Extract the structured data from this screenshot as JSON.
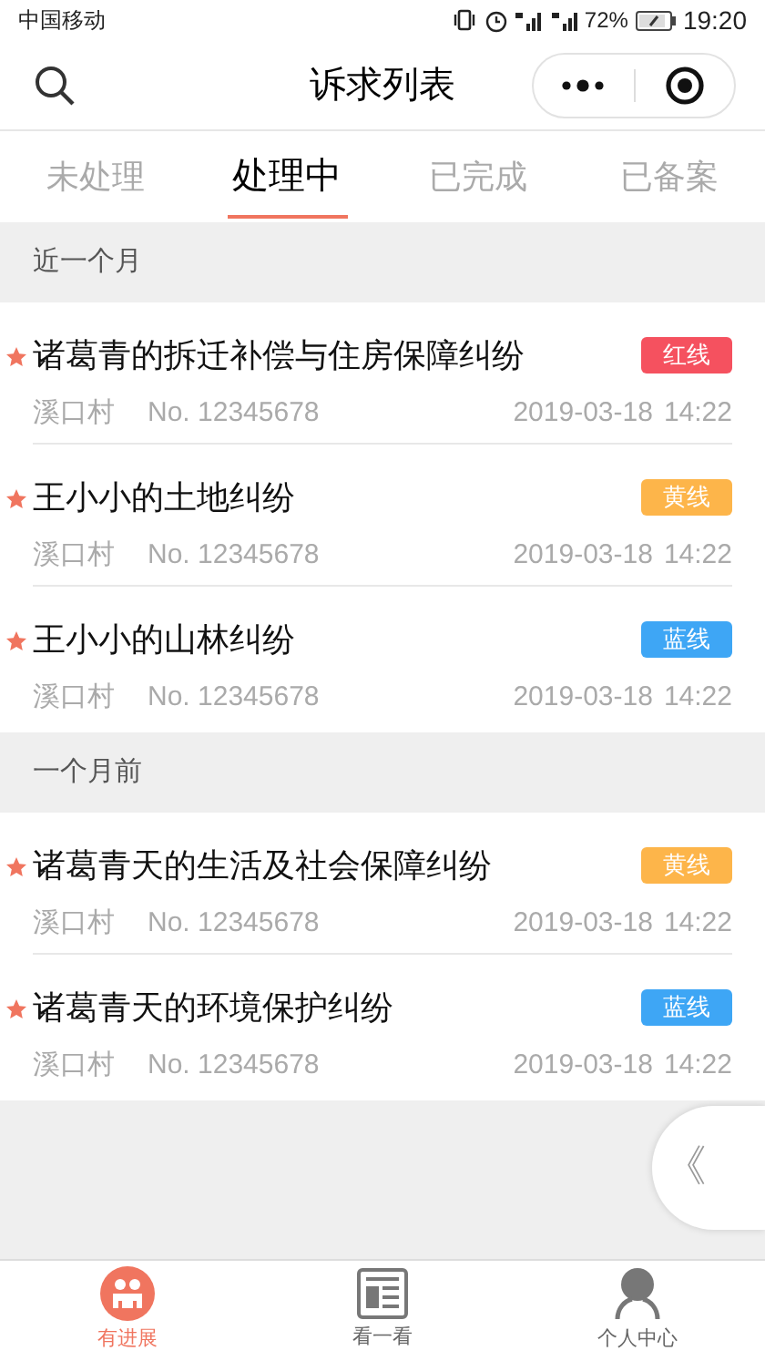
{
  "status_bar": {
    "carrier": "中国移动",
    "battery": "72%",
    "time": "19:20"
  },
  "nav": {
    "title": "诉求列表"
  },
  "tabs": [
    {
      "label": "未处理",
      "selected": false
    },
    {
      "label": "处理中",
      "selected": true
    },
    {
      "label": "已完成",
      "selected": false
    },
    {
      "label": "已备案",
      "selected": false
    }
  ],
  "sections": [
    {
      "title": "近一个月",
      "items": [
        {
          "title": "诸葛青的拆迁补偿与住房保障纠纷",
          "starred": true,
          "tag": "红线",
          "color": "#f5515f",
          "village": "溪口村",
          "number": "No. 12345678",
          "date": "2019-03-18",
          "time": "14:22"
        },
        {
          "title": "王小小的土地纠纷",
          "starred": true,
          "tag": "黄线",
          "color": "#fdb54a",
          "village": "溪口村",
          "number": "No. 12345678",
          "date": "2019-03-18",
          "time": "14:22"
        },
        {
          "title": "王小小的山林纠纷",
          "starred": true,
          "tag": "蓝线",
          "color": "#3ea6f5",
          "village": "溪口村",
          "number": "No. 12345678",
          "date": "2019-03-18",
          "time": "14:22"
        }
      ]
    },
    {
      "title": "一个月前",
      "items": [
        {
          "title": "诸葛青天的生活及社会保障纠纷",
          "starred": true,
          "tag": "黄线",
          "color": "#fdb54a",
          "village": "溪口村",
          "number": "No. 12345678",
          "date": "2019-03-18",
          "time": "14:22"
        },
        {
          "title": "诸葛青天的环境保护纠纷",
          "starred": true,
          "tag": "蓝线",
          "color": "#3ea6f5",
          "village": "溪口村",
          "number": "No. 12345678",
          "date": "2019-03-18",
          "time": "14:22"
        }
      ]
    }
  ],
  "float_button": {
    "label": "《"
  },
  "tab_bar": [
    {
      "kind": "progress",
      "label": "有进展",
      "selected": true
    },
    {
      "kind": "news",
      "label": "看一看",
      "selected": false
    },
    {
      "kind": "person",
      "label": "个人中心",
      "selected": false
    }
  ]
}
